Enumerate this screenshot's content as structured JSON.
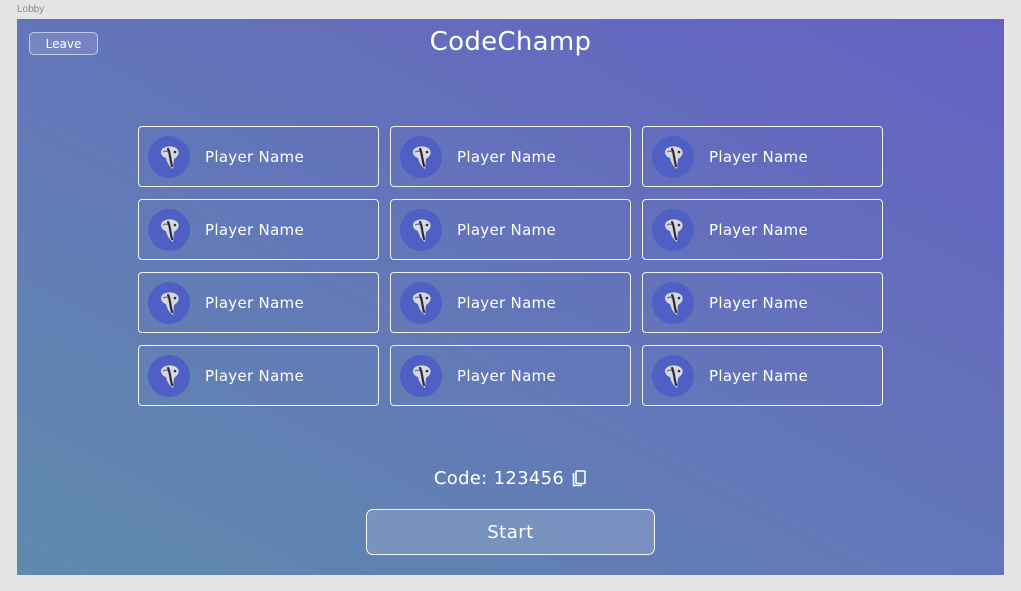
{
  "frame": {
    "label": "Lobby"
  },
  "header": {
    "leave_label": "Leave",
    "title": "CodeChamp"
  },
  "players": [
    {
      "name": "Player Name"
    },
    {
      "name": "Player Name"
    },
    {
      "name": "Player Name"
    },
    {
      "name": "Player Name"
    },
    {
      "name": "Player Name"
    },
    {
      "name": "Player Name"
    },
    {
      "name": "Player Name"
    },
    {
      "name": "Player Name"
    },
    {
      "name": "Player Name"
    },
    {
      "name": "Player Name"
    },
    {
      "name": "Player Name"
    },
    {
      "name": "Player Name"
    }
  ],
  "room": {
    "code_label": "Code:",
    "code_value": "123456",
    "copy_icon": "copy-icon"
  },
  "actions": {
    "start_label": "Start"
  },
  "colors": {
    "gradient_start": "#5f8bad",
    "gradient_end": "#6561c3",
    "avatar_bg": "#4f5fc4",
    "text": "#ffffff"
  }
}
